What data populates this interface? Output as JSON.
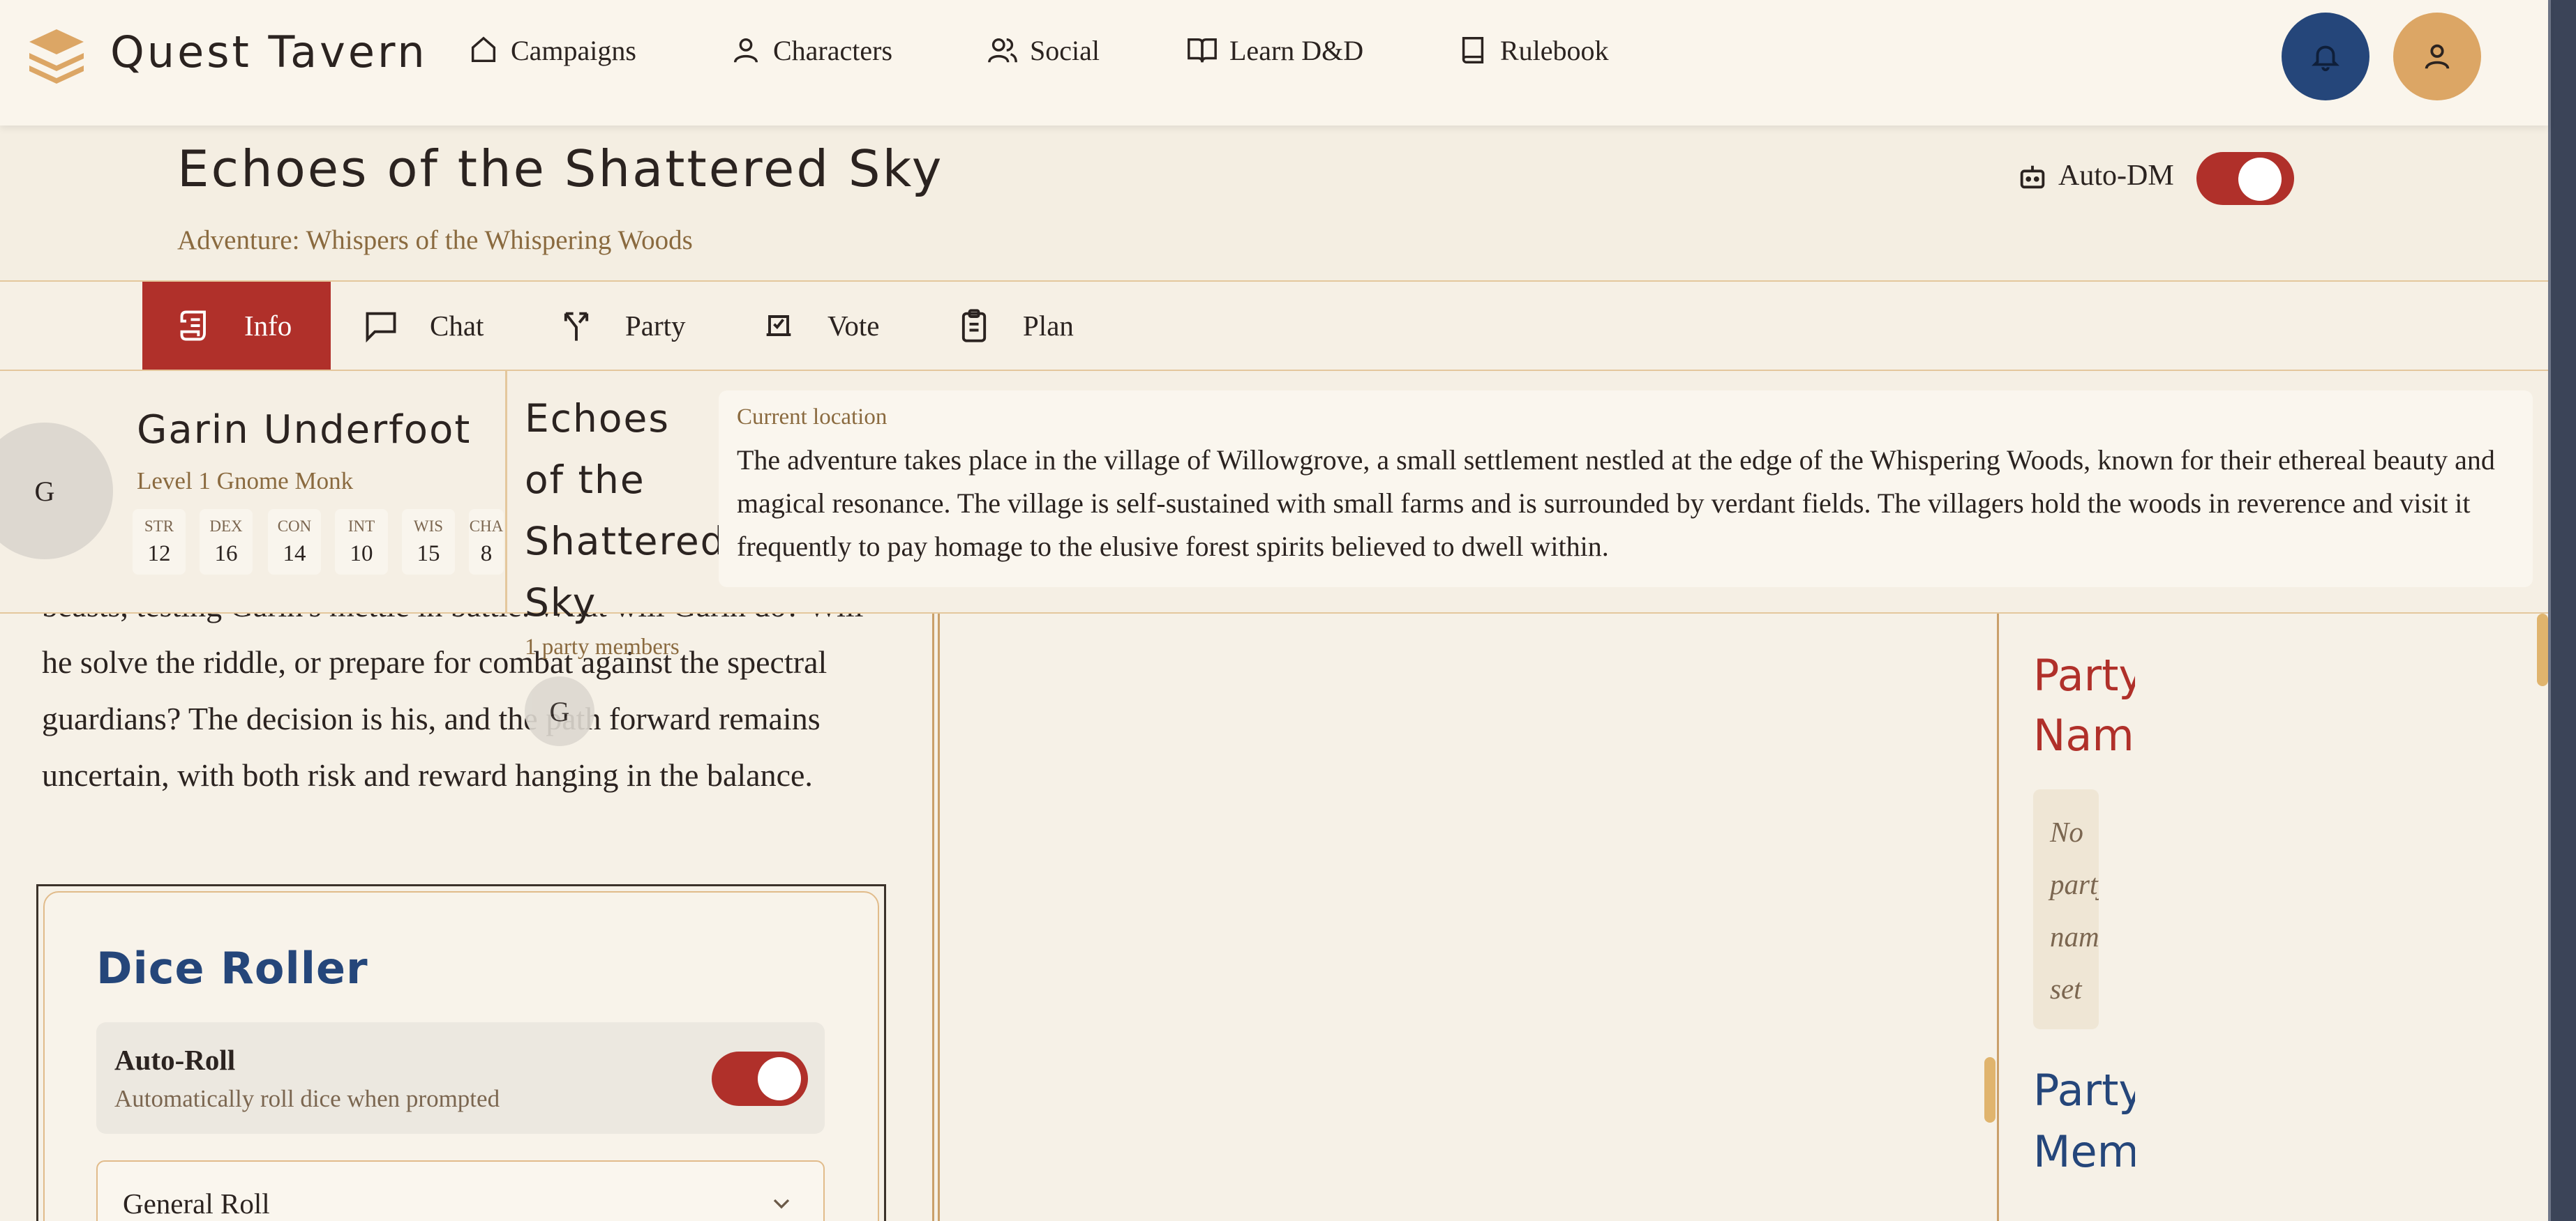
{
  "brand": {
    "name": "Quest Tavern"
  },
  "nav": {
    "campaigns": "Campaigns",
    "characters": "Characters",
    "social": "Social",
    "learn": "Learn D&D",
    "rulebook": "Rulebook"
  },
  "campaign": {
    "title": "Echoes of the Shattered Sky",
    "adventure": "Adventure: Whispers of the Whispering Woods",
    "auto_dm_label": "Auto-DM",
    "auto_dm_on": true
  },
  "tabs": {
    "info": "Info",
    "chat": "Chat",
    "party": "Party",
    "vote": "Vote",
    "plan": "Plan",
    "active": "Info"
  },
  "character": {
    "initial": "G",
    "name": "Garin Underfoot",
    "level": "Level 1 Gnome Monk",
    "stats": [
      {
        "label": "STR",
        "value": "12"
      },
      {
        "label": "DEX",
        "value": "16"
      },
      {
        "label": "CON",
        "value": "14"
      },
      {
        "label": "INT",
        "value": "10"
      },
      {
        "label": "WIS",
        "value": "15"
      },
      {
        "label": "CHA",
        "value": "8"
      }
    ]
  },
  "location": {
    "label": "Current location",
    "text": "The adventure takes place in the village of Willowgrove, a small settlement nestled at the edge of the Whispering Woods, known for their ethereal beauty and magical resonance. The village is self-sustained with small farms and is surrounded by verdant fields. The villagers hold the woods in reverence and visit it frequently to pay homage to the elusive forest spirits believed to dwell within."
  },
  "party_overlay": {
    "count_text": "1 party members",
    "member_initial": "G"
  },
  "narrative": {
    "text": "beasts, testing Garin's mettle in battle. What will Garin do? Will he solve the riddle, or prepare for combat against the spectral guardians? The decision is his, and the path forward remains uncertain, with both risk and reward hanging in the balance."
  },
  "dice_roller": {
    "title": "Dice Roller",
    "auto_roll_title": "Auto-Roll",
    "auto_roll_desc": "Automatically roll dice when prompted",
    "auto_roll_on": true,
    "roll_type": "General Roll"
  },
  "sidebar": {
    "party_name_heading": "Party Name",
    "no_party_name": "No party name set",
    "party_members_heading": "Party Members"
  },
  "colors": {
    "accent_red": "#b0302a",
    "accent_blue": "#25467a",
    "gold": "#dca665",
    "background": "#f6f1e7"
  }
}
